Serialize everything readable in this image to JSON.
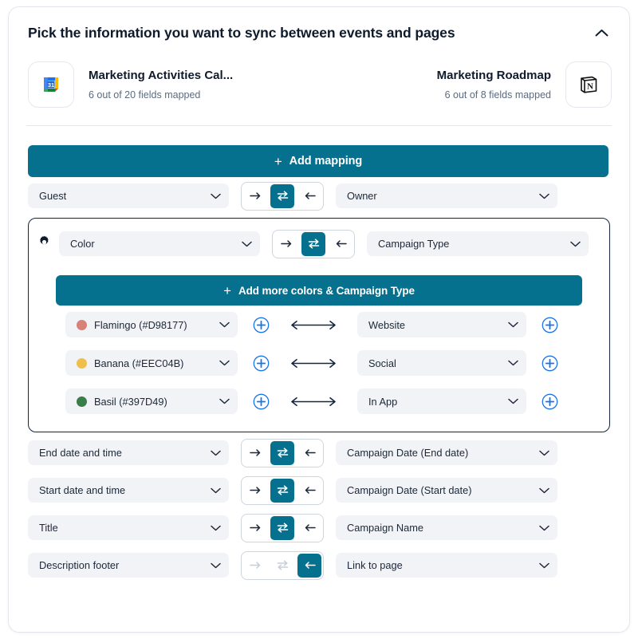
{
  "header": {
    "title": "Pick the information you want to sync between events and pages",
    "collapse_icon": "chevron-up-icon"
  },
  "apps": {
    "left": {
      "icon": "google-calendar-icon",
      "name": "Marketing Activities Cal...",
      "subtitle": "6 out of 20 fields mapped"
    },
    "right": {
      "icon": "notion-icon",
      "name": "Marketing Roadmap",
      "subtitle": "6 out of 8 fields mapped"
    }
  },
  "add_mapping_button": {
    "label": "Add mapping",
    "icon": "plus-icon"
  },
  "direction_icons": {
    "right": "arrow-right-icon",
    "both": "arrows-bidirectional-icon",
    "left": "arrow-left-icon"
  },
  "colors": {
    "brand_teal": "#05718F",
    "border_navy": "#142740",
    "field_bg": "#F1F3F7",
    "plus_blue": "#1A73E8"
  },
  "mappings": [
    {
      "left_field": "Guest",
      "right_field": "Owner",
      "direction": "both",
      "disabled_directions": [],
      "has_gear": false
    },
    {
      "left_field": "Color",
      "right_field": "Campaign Type",
      "direction": "both",
      "disabled_directions": [],
      "has_gear": true,
      "gear_icon": "gear-icon",
      "expanded": true,
      "add_more_button": {
        "label": "Add more colors & Campaign Type",
        "icon": "plus-icon"
      },
      "value_pairs": [
        {
          "color_name": "Flamingo (#D98177)",
          "swatch_hex": "#D98177",
          "option": "Website",
          "arrow": "arrows-bidirectional-icon"
        },
        {
          "color_name": "Banana (#EEC04B)",
          "swatch_hex": "#EEC04B",
          "option": "Social",
          "arrow": "arrows-bidirectional-icon"
        },
        {
          "color_name": "Basil (#397D49)",
          "swatch_hex": "#397D49",
          "option": "In App",
          "arrow": "arrows-bidirectional-icon"
        }
      ]
    },
    {
      "left_field": "End date and time",
      "right_field": "Campaign Date (End date)",
      "direction": "both",
      "disabled_directions": [],
      "has_gear": false
    },
    {
      "left_field": "Start date and time",
      "right_field": "Campaign Date (Start date)",
      "direction": "both",
      "disabled_directions": [],
      "has_gear": false
    },
    {
      "left_field": "Title",
      "right_field": "Campaign Name",
      "direction": "both",
      "disabled_directions": [],
      "has_gear": false
    },
    {
      "left_field": "Description footer",
      "right_field": "Link to page",
      "direction": "left",
      "disabled_directions": [
        "right",
        "both"
      ],
      "has_gear": false
    }
  ]
}
